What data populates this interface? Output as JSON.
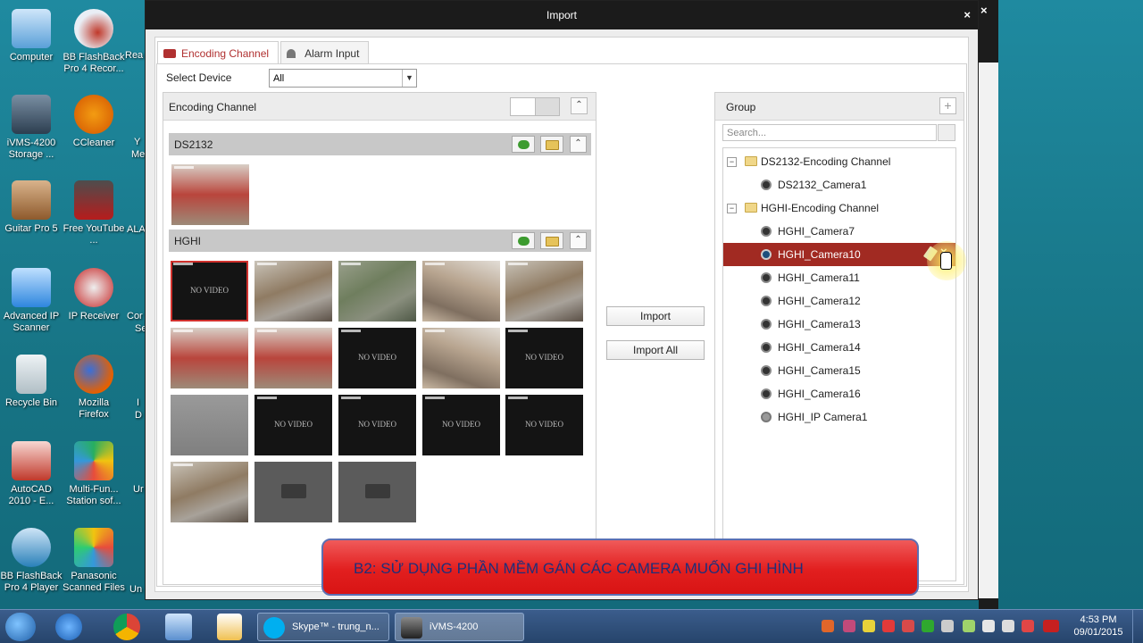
{
  "desktop": {
    "icons": [
      {
        "label": "Computer",
        "icon": "computer-icon",
        "color": "#5aa0d8"
      },
      {
        "label": "BB FlashBack Pro 4 Recor...",
        "icon": "flashback-recorder-icon",
        "color": "#c0392b"
      },
      {
        "label": "iVMS-4200 Storage ...",
        "icon": "ivms-storage-icon",
        "color": "#2c3e50"
      },
      {
        "label": "CCleaner",
        "icon": "ccleaner-icon",
        "color": "#d35400"
      },
      {
        "label": "Guitar Pro 5",
        "icon": "guitar-pro-icon",
        "color": "#8e5a2c"
      },
      {
        "label": "Free YouTube ...",
        "icon": "youtube-download-icon",
        "color": "#b71c1c"
      },
      {
        "label": "Advanced IP Scanner",
        "icon": "ip-scanner-icon",
        "color": "#2e86de"
      },
      {
        "label": "IP Receiver",
        "icon": "ip-receiver-icon",
        "color": "#c62828"
      },
      {
        "label": "Recycle Bin",
        "icon": "recycle-bin-icon",
        "color": "#b0bec5"
      },
      {
        "label": "Mozilla Firefox",
        "icon": "firefox-icon",
        "color": "#e66000"
      },
      {
        "label": "AutoCAD 2010 - E...",
        "icon": "autocad-icon",
        "color": "#c0392b"
      },
      {
        "label": "Multi-Fun... Station sof...",
        "icon": "multifunction-station-icon",
        "color": "#27ae60"
      },
      {
        "label": "BB FlashBack Pro 4 Player",
        "icon": "flashback-player-icon",
        "color": "#2980b9"
      },
      {
        "label": "Panasonic Scanned Files",
        "icon": "panasonic-folder-icon",
        "color": "#f1c40f"
      }
    ],
    "partial_labels": [
      "Rea",
      "Y",
      "Me",
      "ALA",
      "Cor",
      "Se",
      "I",
      "D",
      "Ur",
      "Un"
    ]
  },
  "dialog": {
    "title": "Import",
    "close": "×",
    "tabs": [
      {
        "label": "Encoding Channel",
        "active": true
      },
      {
        "label": "Alarm Input",
        "active": false
      }
    ],
    "select_device": {
      "label": "Select Device",
      "value": "All"
    },
    "left_panel": {
      "title": "Encoding Channel",
      "devices": [
        {
          "name": "DS2132"
        },
        {
          "name": "HGHI"
        }
      ],
      "no_video_text": "NO VIDEO"
    },
    "buttons": {
      "import": "Import",
      "import_all": "Import All"
    },
    "right_panel": {
      "title": "Group",
      "search_placeholder": "Search...",
      "tree": [
        {
          "label": "DS2132-Encoding Channel",
          "type": "group",
          "toggle": "−"
        },
        {
          "label": "DS2132_Camera1",
          "type": "camera"
        },
        {
          "label": "HGHI-Encoding Channel",
          "type": "group",
          "toggle": "−"
        },
        {
          "label": "HGHI_Camera7",
          "type": "camera"
        },
        {
          "label": "HGHI_Camera10",
          "type": "camera",
          "selected": true
        },
        {
          "label": "HGHI_Camera11",
          "type": "camera"
        },
        {
          "label": "HGHI_Camera12",
          "type": "camera"
        },
        {
          "label": "HGHI_Camera13",
          "type": "camera"
        },
        {
          "label": "HGHI_Camera14",
          "type": "camera"
        },
        {
          "label": "HGHI_Camera15",
          "type": "camera"
        },
        {
          "label": "HGHI_Camera16",
          "type": "camera"
        },
        {
          "label": "HGHI_IP Camera1",
          "type": "ip-camera"
        }
      ]
    }
  },
  "banner": {
    "text": "B2: SỬ DỤNG PHẦN MỀM GÁN CÁC CAMERA MUỐN GHI HÌNH"
  },
  "taskbar": {
    "tasks": [
      {
        "label": "Skype™ - trung_n..."
      },
      {
        "label": "iVMS-4200"
      }
    ],
    "clock": {
      "time": "4:53 PM",
      "date": "09/01/2015"
    }
  },
  "colors": {
    "accent": "#a12a22",
    "banner": "#e21f1f",
    "banner_text": "#1f2f7a"
  }
}
